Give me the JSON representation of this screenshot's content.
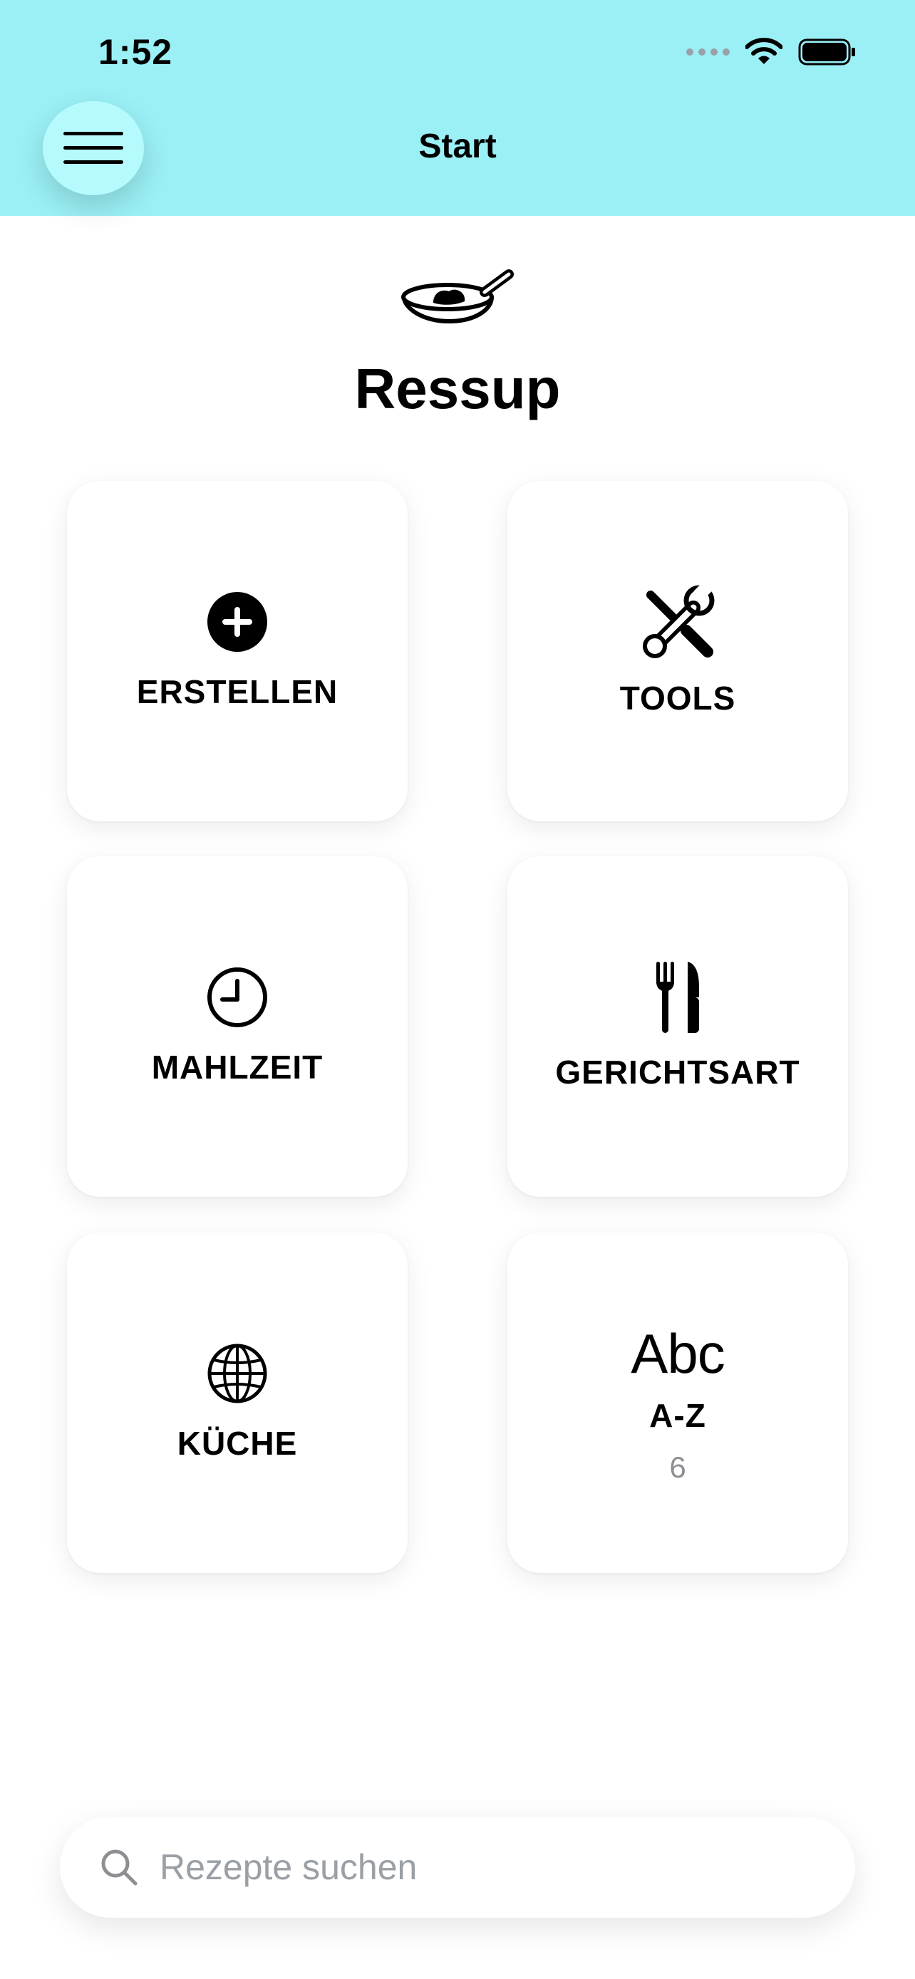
{
  "status_bar": {
    "time": "1:52"
  },
  "header": {
    "title": "Start"
  },
  "app": {
    "name": "Ressup"
  },
  "tiles": [
    {
      "label": "ERSTELLEN",
      "icon": "plus-circle-icon"
    },
    {
      "label": "TOOLS",
      "icon": "tools-icon"
    },
    {
      "label": "MAHLZEIT",
      "icon": "clock-icon"
    },
    {
      "label": "GERICHTSART",
      "icon": "fork-knife-icon"
    },
    {
      "label": "KÜCHE",
      "icon": "globe-icon"
    },
    {
      "label": "A-Z",
      "icon_text": "Abc",
      "count": "6"
    }
  ],
  "search": {
    "placeholder": "Rezepte suchen",
    "value": ""
  }
}
